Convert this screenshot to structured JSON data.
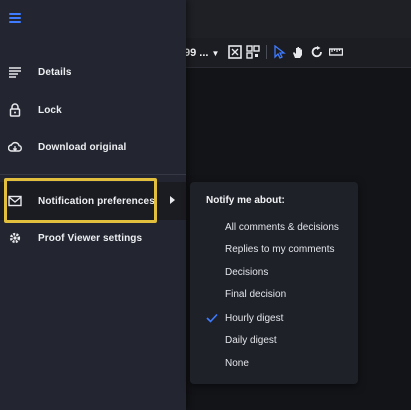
{
  "toolbar": {
    "zoom_label": "99 ..."
  },
  "drawer": {
    "items": [
      {
        "label": "Details",
        "icon": "details-lines-icon"
      },
      {
        "label": "Lock",
        "icon": "lock-icon"
      },
      {
        "label": "Download original",
        "icon": "cloud-download-icon"
      },
      {
        "label": "Notification preferences",
        "icon": "envelope-icon"
      },
      {
        "label": "Proof Viewer settings",
        "icon": "gear-icon"
      }
    ]
  },
  "submenu": {
    "title": "Notify me about:",
    "options": [
      {
        "label": "All comments & decisions",
        "checked": false
      },
      {
        "label": "Replies to my comments",
        "checked": false
      },
      {
        "label": "Decisions",
        "checked": false
      },
      {
        "label": "Final decision",
        "checked": false
      },
      {
        "label": "Hourly digest",
        "checked": true
      },
      {
        "label": "Daily digest",
        "checked": false
      },
      {
        "label": "None",
        "checked": false
      }
    ]
  },
  "colors": {
    "accent": "#3e7bff",
    "highlight": "#e3bf3e",
    "drawer_bg": "#232530"
  }
}
